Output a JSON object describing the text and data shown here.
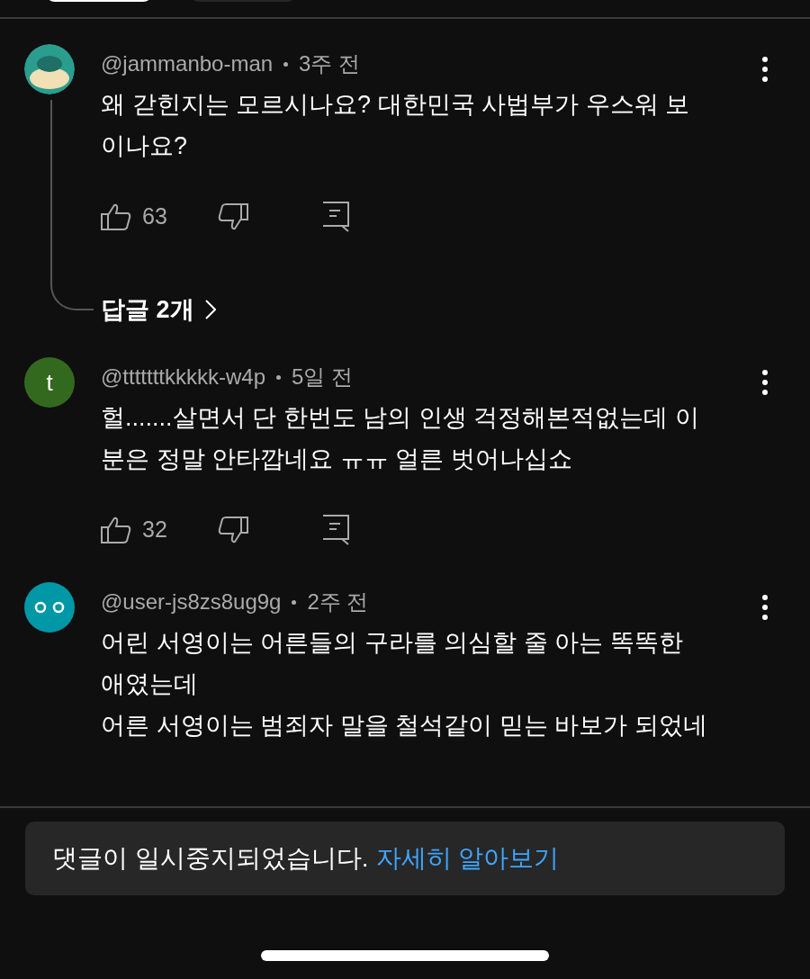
{
  "comments": [
    {
      "author": "@jammanbo-man",
      "time": "3주 전",
      "text": "왜 갇힌지는 모르시나요? 대한민국 사법부가 우스워 보이나요?",
      "likes": "63",
      "replies": "답글 2개"
    },
    {
      "author": "@tttttttkkkkk-w4p",
      "time": "5일 전",
      "avatar": {
        "kind": "letter",
        "letter": "t",
        "color": "#33691e"
      },
      "text": "헐.......살면서 단 한번도 남의 인생 걱정해본적없는데 이분은 정말 안타깝네요 ㅠㅠ 얼른 벗어나십쇼",
      "likes": "32"
    },
    {
      "author": "@user-js8zs8ug9g",
      "time": "2주 전",
      "avatar": {
        "kind": "eyes",
        "color": "#0097a7"
      },
      "lines": [
        "어린 서영이는 어른들의 구라를 의심할 줄 아는 똑똑한 애였는데",
        "어른 서영이는 범죄자 말을 철석같이 믿는 바보가 되었네"
      ]
    }
  ],
  "notice": {
    "text": "댓글이 일시중지되었습니다.",
    "link": "자세히 알아보기"
  }
}
